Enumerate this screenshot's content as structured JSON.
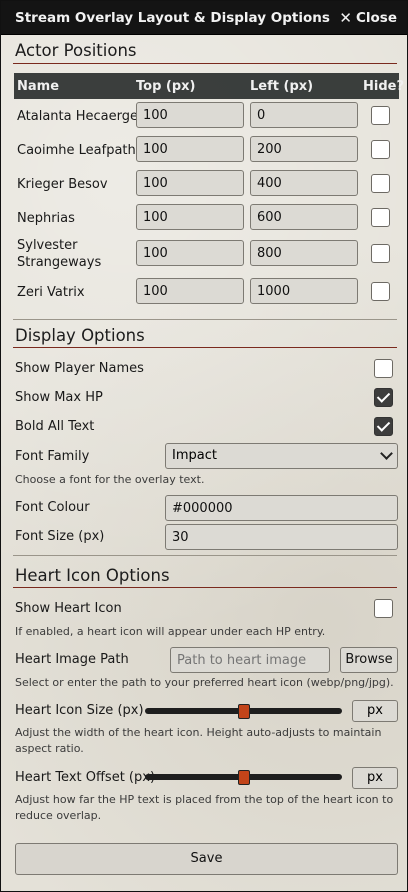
{
  "window": {
    "title": "Stream Overlay Layout & Display Options",
    "close_label": "Close",
    "close_icon": "x-icon"
  },
  "actor_positions": {
    "title": "Actor Positions",
    "headers": {
      "name": "Name",
      "top": "Top (px)",
      "left": "Left (px)",
      "hide": "Hide?"
    },
    "rows": [
      {
        "name": "Atalanta Hecaerge",
        "top": "100",
        "left": "0",
        "hide": false
      },
      {
        "name": "Caoimhe Leafpath",
        "top": "100",
        "left": "200",
        "hide": false
      },
      {
        "name": "Krieger Besov",
        "top": "100",
        "left": "400",
        "hide": false
      },
      {
        "name": "Nephrias",
        "top": "100",
        "left": "600",
        "hide": false
      },
      {
        "name": "Sylvester Strangeways",
        "top": "100",
        "left": "800",
        "hide": false
      },
      {
        "name": "Zeri Vatrix",
        "top": "100",
        "left": "1000",
        "hide": false
      }
    ]
  },
  "display_options": {
    "title": "Display Options",
    "show_player_names": {
      "label": "Show Player Names",
      "checked": false
    },
    "show_max_hp": {
      "label": "Show Max HP",
      "checked": true
    },
    "bold_all_text": {
      "label": "Bold All Text",
      "checked": true
    },
    "font_family": {
      "label": "Font Family",
      "value": "Impact",
      "hint": "Choose a font for the overlay text."
    },
    "font_colour": {
      "label": "Font Colour",
      "value": "#000000"
    },
    "font_size": {
      "label": "Font Size (px)",
      "value": "30"
    }
  },
  "heart_icon_options": {
    "title": "Heart Icon Options",
    "show_heart_icon": {
      "label": "Show Heart Icon",
      "checked": false,
      "hint": "If enabled, a heart icon will appear under each HP entry."
    },
    "heart_image_path": {
      "label": "Heart Image Path",
      "placeholder": "Path to heart image",
      "browse_label": "Browse",
      "hint": "Select or enter the path to your preferred heart icon (webp/png/jpg)."
    },
    "heart_icon_size": {
      "label": "Heart Icon Size (px)",
      "unit": "px",
      "level": 0.5,
      "hint": "Adjust the width of the heart icon. Height auto-adjusts to maintain aspect ratio."
    },
    "heart_text_offset": {
      "label": "Heart Text Offset (px)",
      "unit": "px",
      "level": 0.5,
      "hint": "Adjust how far the HP text is placed from the top of the heart icon to reduce overlap."
    }
  },
  "save_label": "Save",
  "colors": {
    "accent_rule": "#7a2a1e",
    "slider_thumb": "#c24419",
    "titlebar": "#141414"
  }
}
